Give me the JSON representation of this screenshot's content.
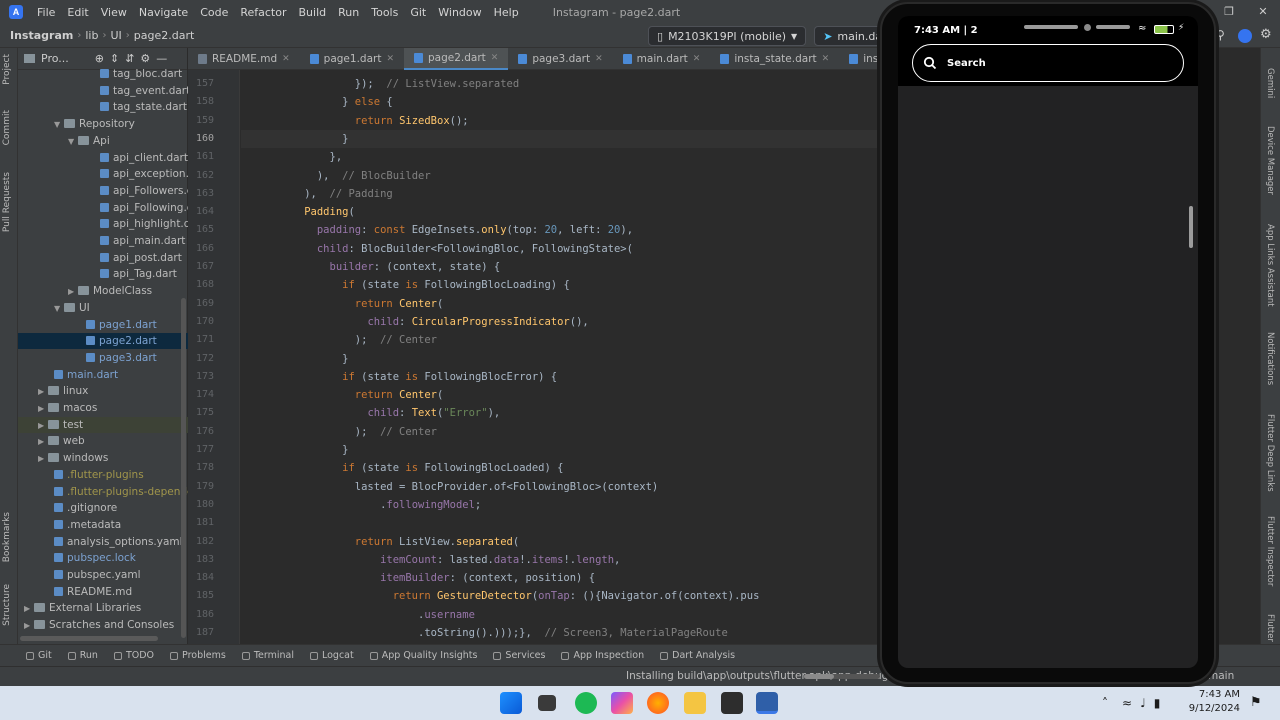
{
  "titlebar": {
    "menus": [
      "File",
      "Edit",
      "View",
      "Navigate",
      "Code",
      "Refactor",
      "Build",
      "Run",
      "Tools",
      "Git",
      "Window",
      "Help"
    ],
    "window_title": "Instagram - page2.dart"
  },
  "navbar": {
    "breadcrumbs": [
      "Instagram",
      "lib",
      "UI",
      "page2.dart"
    ],
    "device": "M2103K19PI (mobile)",
    "run_config": "main.dart"
  },
  "project": {
    "title": "Pro...",
    "items": [
      {
        "label": "tag_bloc.dart",
        "indent": 82,
        "kind": "file"
      },
      {
        "label": "tag_event.dart",
        "indent": 82,
        "kind": "file"
      },
      {
        "label": "tag_state.dart",
        "indent": 82,
        "kind": "file"
      },
      {
        "label": "Repository",
        "indent": 36,
        "kind": "folder",
        "open": true
      },
      {
        "label": "Api",
        "indent": 50,
        "kind": "folder",
        "open": true
      },
      {
        "label": "api_client.dart",
        "indent": 82,
        "kind": "file"
      },
      {
        "label": "api_exception.dar",
        "indent": 82,
        "kind": "file"
      },
      {
        "label": "api_Followers.dar",
        "indent": 82,
        "kind": "file"
      },
      {
        "label": "api_Following.dar",
        "indent": 82,
        "kind": "file"
      },
      {
        "label": "api_highlight.dart",
        "indent": 82,
        "kind": "file"
      },
      {
        "label": "api_main.dart",
        "indent": 82,
        "kind": "file"
      },
      {
        "label": "api_post.dart",
        "indent": 82,
        "kind": "file"
      },
      {
        "label": "api_Tag.dart",
        "indent": 82,
        "kind": "file"
      },
      {
        "label": "ModelClass",
        "indent": 50,
        "kind": "folder",
        "open": false
      },
      {
        "label": "UI",
        "indent": 36,
        "kind": "folder",
        "open": true
      },
      {
        "label": "page1.dart",
        "indent": 68,
        "kind": "file",
        "style": "link"
      },
      {
        "label": "page2.dart",
        "indent": 68,
        "kind": "file",
        "style": "link",
        "selected": true
      },
      {
        "label": "page3.dart",
        "indent": 68,
        "kind": "file",
        "style": "link"
      },
      {
        "label": "main.dart",
        "indent": 36,
        "kind": "file",
        "style": "link"
      },
      {
        "label": "linux",
        "indent": 20,
        "kind": "folder",
        "open": false
      },
      {
        "label": "macos",
        "indent": 20,
        "kind": "folder",
        "open": false
      },
      {
        "label": "test",
        "indent": 20,
        "kind": "folder",
        "open": false,
        "hl": true
      },
      {
        "label": "web",
        "indent": 20,
        "kind": "folder",
        "open": false
      },
      {
        "label": "windows",
        "indent": 20,
        "kind": "folder",
        "open": false
      },
      {
        "label": ".flutter-plugins",
        "indent": 36,
        "kind": "file",
        "style": "ylw"
      },
      {
        "label": ".flutter-plugins-dependenc",
        "indent": 36,
        "kind": "file",
        "style": "ylw"
      },
      {
        "label": ".gitignore",
        "indent": 36,
        "kind": "file"
      },
      {
        "label": ".metadata",
        "indent": 36,
        "kind": "file"
      },
      {
        "label": "analysis_options.yaml",
        "indent": 36,
        "kind": "file"
      },
      {
        "label": "pubspec.lock",
        "indent": 36,
        "kind": "file",
        "style": "link"
      },
      {
        "label": "pubspec.yaml",
        "indent": 36,
        "kind": "file"
      },
      {
        "label": "README.md",
        "indent": 36,
        "kind": "file"
      },
      {
        "label": "External Libraries",
        "indent": 6,
        "kind": "folder",
        "open": false
      },
      {
        "label": "Scratches and Consoles",
        "indent": 6,
        "kind": "folder",
        "open": false
      }
    ]
  },
  "tabs": [
    {
      "label": "README.md"
    },
    {
      "label": "page1.dart"
    },
    {
      "label": "page2.dart",
      "active": true
    },
    {
      "label": "page3.dart"
    },
    {
      "label": "main.dart"
    },
    {
      "label": "insta_state.dart"
    },
    {
      "label": "insta_event.dart"
    }
  ],
  "editor": {
    "line_numbers": [
      "157",
      "158",
      "159",
      "160",
      "161",
      "162",
      "163",
      "164",
      "165",
      "166",
      "167",
      "168",
      "169",
      "170",
      "171",
      "172",
      "173",
      "174",
      "175",
      "176",
      "177",
      "178",
      "179",
      "180",
      "181",
      "182",
      "183",
      "184",
      "185",
      "186",
      "187"
    ],
    "current_line": "160",
    "lines": [
      "                  });  // ListView.separated",
      "                } else {",
      "                  return SizedBox();",
      "                }",
      "              },",
      "            ),  // BlocBuilder",
      "          ),  // Padding",
      "          Padding(",
      "            padding: const EdgeInsets.only(top: 20, left: 20),",
      "            child: BlocBuilder<FollowingBloc, FollowingState>(",
      "              builder: (context, state) {",
      "                if (state is FollowingBlocLoading) {",
      "                  return Center(",
      "                    child: CircularProgressIndicator(),",
      "                  );  // Center",
      "                }",
      "                if (state is FollowingBlocError) {",
      "                  return Center(",
      "                    child: Text(\"Error\"),",
      "                  );  // Center",
      "                }",
      "                if (state is FollowingBlocLoaded) {",
      "                  lasted = BlocProvider.of<FollowingBloc>(context)",
      "                      .followingModel;",
      "",
      "                  return ListView.separated(",
      "                      itemCount: lasted.data!.items!.length,",
      "                      itemBuilder: (context, position) {",
      "                        return GestureDetector(onTap: (){Navigator.of(context).pus",
      "                            .username",
      "                            .toString().)));},  // Screen3, MaterialPageRoute"
    ]
  },
  "bottom_tools": [
    "Git",
    "Run",
    "TODO",
    "Problems",
    "Terminal",
    "Logcat",
    "App Quality Insights",
    "Services",
    "App Inspection",
    "Dart Analysis"
  ],
  "status": {
    "message": "Installing build\\app\\outputs\\flutter-apk\\app-debug.apk...",
    "progress": 0.4,
    "branch": "main",
    "right_edge_text": ".data!."
  },
  "right_tools": [
    "Gemini",
    "Device Manager",
    "App Links Assistant",
    "Notifications",
    "Flutter Deep Links",
    "Flutter Inspector",
    "Flutter P"
  ],
  "left_tools": [
    "Project",
    "Commit",
    "Pull Requests",
    "Bookmarks",
    "Structure"
  ],
  "phone": {
    "time": "7:43 AM | 2",
    "search_label": "Search"
  },
  "taskbar": {
    "time": "7:43 AM",
    "date": "9/12/2024"
  },
  "colors": {
    "ide_bg": "#2b2b2b",
    "panel_bg": "#3c3f41",
    "accent": "#4a88c7"
  }
}
